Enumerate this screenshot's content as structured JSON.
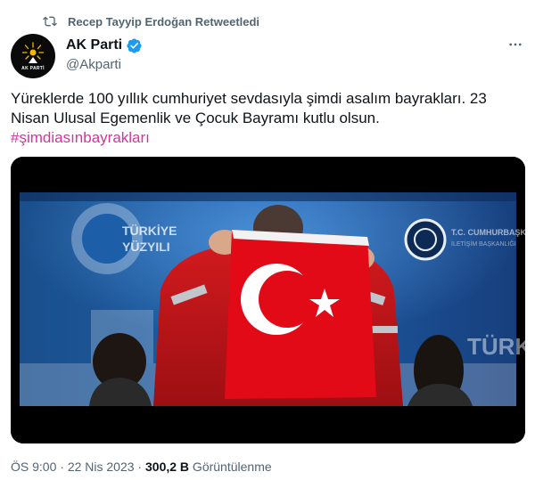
{
  "retweet": {
    "icon": "retweet-icon",
    "label": "Recep Tayyip Erdoğan Retweetledi"
  },
  "author": {
    "avatar_icon": "ak-parti-logo",
    "avatar_text": "AK PARTİ",
    "name": "AK Parti",
    "verified_icon": "verified-badge-icon",
    "handle": "@Akparti"
  },
  "more_icon": "more-options-icon",
  "tweet": {
    "line1": "Yüreklerde 100 yıllık cumhuriyet sevdasıyla şimdi asalım bayrakları. 23",
    "line2": "Nisan Ulusal Egemenlik ve Çocuk Bayramı kutlu olsun.",
    "hashtag": "#şimdiasınbayrakları"
  },
  "media": {
    "description_icon": "video-thumbnail",
    "left_sign_text": "TÜRKİYE YÜZYILI",
    "right_sign_text": "T.C. CUMHURBAŞKANLIĞI",
    "right_bottom_text": "TÜRKİ"
  },
  "meta": {
    "time": "ÖS 9:00",
    "separator1": " · ",
    "date": "22 Nis 2023",
    "separator2": " · ",
    "views_count": "300,2 B",
    "views_label": " Görüntülenme"
  },
  "colors": {
    "text_primary": "#0f1419",
    "text_secondary": "#536471",
    "hashtag": "#d6339c",
    "verified": "#1d9bf0",
    "flag_red": "#e30a17"
  }
}
